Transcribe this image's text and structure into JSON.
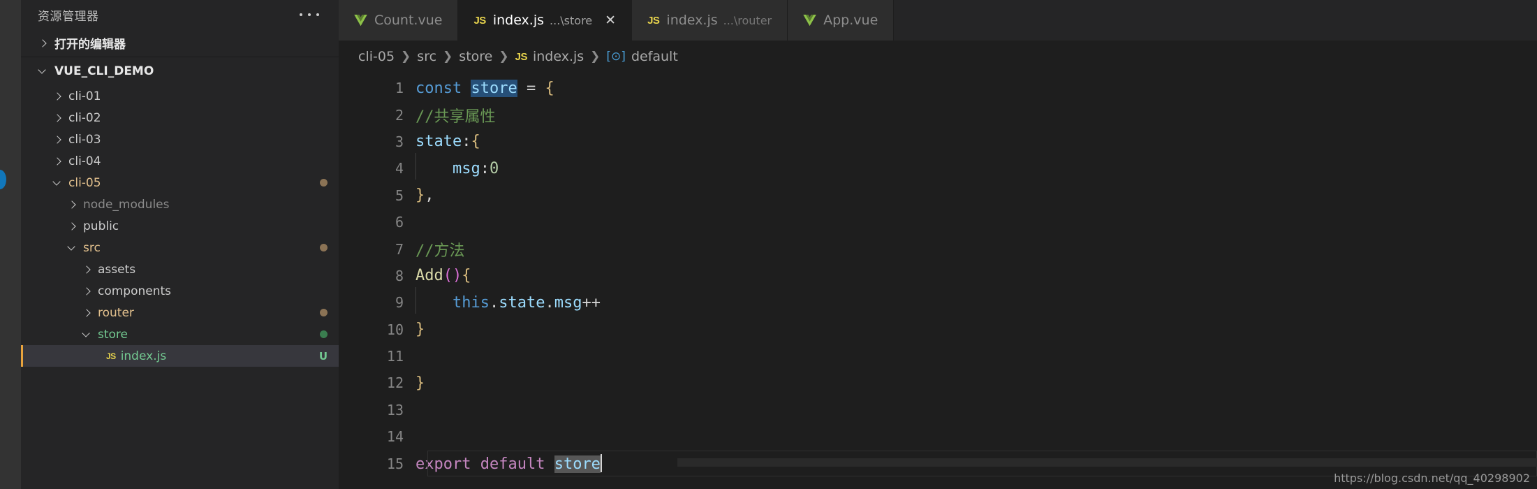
{
  "activity_bar": {
    "notification_dot": "blue-status-dot",
    "accent_color": "#1177bb"
  },
  "sidebar": {
    "header_title": "资源管理器",
    "more_actions_label": "...",
    "open_editors_label": "打开的编辑器",
    "root_label": "VUE_CLI_DEMO",
    "tree": [
      {
        "label": "cli-01",
        "indent": 1,
        "expanded": false,
        "color": "#cccccc",
        "dot": null,
        "badge": null,
        "selected": false
      },
      {
        "label": "cli-02",
        "indent": 1,
        "expanded": false,
        "color": "#cccccc",
        "dot": null,
        "badge": null,
        "selected": false
      },
      {
        "label": "cli-03",
        "indent": 1,
        "expanded": false,
        "color": "#cccccc",
        "dot": null,
        "badge": null,
        "selected": false
      },
      {
        "label": "cli-04",
        "indent": 1,
        "expanded": false,
        "color": "#cccccc",
        "dot": null,
        "badge": null,
        "selected": false
      },
      {
        "label": "cli-05",
        "indent": 1,
        "expanded": true,
        "color": "#e2c08d",
        "dot": "#8b7355",
        "badge": null,
        "selected": false
      },
      {
        "label": "node_modules",
        "indent": 2,
        "expanded": false,
        "color": "#8a8a8a",
        "dot": null,
        "badge": null,
        "selected": false
      },
      {
        "label": "public",
        "indent": 2,
        "expanded": false,
        "color": "#cccccc",
        "dot": null,
        "badge": null,
        "selected": false
      },
      {
        "label": "src",
        "indent": 2,
        "expanded": true,
        "color": "#e2c08d",
        "dot": "#8b7355",
        "badge": null,
        "selected": false
      },
      {
        "label": "assets",
        "indent": 3,
        "expanded": false,
        "color": "#cccccc",
        "dot": null,
        "badge": null,
        "selected": false
      },
      {
        "label": "components",
        "indent": 3,
        "expanded": false,
        "color": "#cccccc",
        "dot": null,
        "badge": null,
        "selected": false
      },
      {
        "label": "router",
        "indent": 3,
        "expanded": false,
        "color": "#e2c08d",
        "dot": "#8b7355",
        "badge": null,
        "selected": false
      },
      {
        "label": "store",
        "indent": 3,
        "expanded": true,
        "color": "#73c991",
        "dot": "#3a7d4f",
        "badge": null,
        "selected": false
      },
      {
        "label": "index.js",
        "indent": 4,
        "file": "js",
        "color": "#73c991",
        "dot": null,
        "badge": "U",
        "badge_color": "#73c991",
        "selected": true
      }
    ]
  },
  "tabs": [
    {
      "icon": "vue-icon",
      "name": "Count.vue",
      "dir": "",
      "active": false,
      "closable": false
    },
    {
      "icon": "js-icon",
      "name": "index.js",
      "dir": "...\\store",
      "active": true,
      "closable": true,
      "close_label": "✕"
    },
    {
      "icon": "js-icon",
      "name": "index.js",
      "dir": "...\\router",
      "active": false,
      "closable": false
    },
    {
      "icon": "vue-icon",
      "name": "App.vue",
      "dir": "",
      "active": false,
      "closable": false
    }
  ],
  "breadcrumb": [
    {
      "label": "cli-05",
      "icon": null
    },
    {
      "label": "src",
      "icon": null
    },
    {
      "label": "store",
      "icon": null
    },
    {
      "label": "index.js",
      "icon": "js-icon"
    },
    {
      "label": "default",
      "icon": "symbol-object-icon"
    }
  ],
  "editor": {
    "language": "javascript",
    "cursor_line": 15,
    "line_numbers": [
      "1",
      "2",
      "3",
      "4",
      "5",
      "6",
      "7",
      "8",
      "9",
      "10",
      "11",
      "12",
      "13",
      "14",
      "15"
    ],
    "lines": [
      {
        "n": 1,
        "tokens": [
          {
            "t": "const",
            "c": "k"
          },
          {
            "t": " ",
            "c": "op"
          },
          {
            "t": "store",
            "c": "var sel"
          },
          {
            "t": " ",
            "c": "op"
          },
          {
            "t": "=",
            "c": "op"
          },
          {
            "t": " ",
            "c": "op"
          },
          {
            "t": "{",
            "c": "br"
          }
        ]
      },
      {
        "n": 2,
        "tokens": [
          {
            "t": "//共享属性",
            "c": "cmt"
          }
        ]
      },
      {
        "n": 3,
        "tokens": [
          {
            "t": "state",
            "c": "var"
          },
          {
            "t": ":",
            "c": "op"
          },
          {
            "t": "{",
            "c": "br"
          }
        ]
      },
      {
        "n": 4,
        "indent": true,
        "tokens": [
          {
            "t": "    ",
            "c": "op"
          },
          {
            "t": "msg",
            "c": "var"
          },
          {
            "t": ":",
            "c": "op"
          },
          {
            "t": "0",
            "c": "num"
          }
        ]
      },
      {
        "n": 5,
        "tokens": [
          {
            "t": "}",
            "c": "br"
          },
          {
            "t": ",",
            "c": "op"
          }
        ]
      },
      {
        "n": 6,
        "tokens": []
      },
      {
        "n": 7,
        "tokens": [
          {
            "t": "//方法",
            "c": "cmt"
          }
        ]
      },
      {
        "n": 8,
        "tokens": [
          {
            "t": "Add",
            "c": "fn"
          },
          {
            "t": "()",
            "c": "br2"
          },
          {
            "t": "{",
            "c": "br"
          }
        ]
      },
      {
        "n": 9,
        "indent": true,
        "tokens": [
          {
            "t": "    ",
            "c": "op"
          },
          {
            "t": "this",
            "c": "this"
          },
          {
            "t": ".",
            "c": "op"
          },
          {
            "t": "state",
            "c": "var"
          },
          {
            "t": ".",
            "c": "op"
          },
          {
            "t": "msg",
            "c": "var"
          },
          {
            "t": "++",
            "c": "op"
          }
        ]
      },
      {
        "n": 10,
        "tokens": [
          {
            "t": "}",
            "c": "br"
          }
        ]
      },
      {
        "n": 11,
        "tokens": []
      },
      {
        "n": 12,
        "tokens": [
          {
            "t": "}",
            "c": "br"
          }
        ]
      },
      {
        "n": 13,
        "tokens": []
      },
      {
        "n": 14,
        "tokens": []
      },
      {
        "n": 15,
        "current": true,
        "caret": true,
        "tokens": [
          {
            "t": "export",
            "c": "kw2"
          },
          {
            "t": " ",
            "c": "op"
          },
          {
            "t": "default",
            "c": "kw2"
          },
          {
            "t": " ",
            "c": "op"
          },
          {
            "t": "store",
            "c": "var wh"
          }
        ]
      }
    ]
  },
  "watermark": {
    "text": "https://blog.csdn.net/qq_40298902"
  }
}
